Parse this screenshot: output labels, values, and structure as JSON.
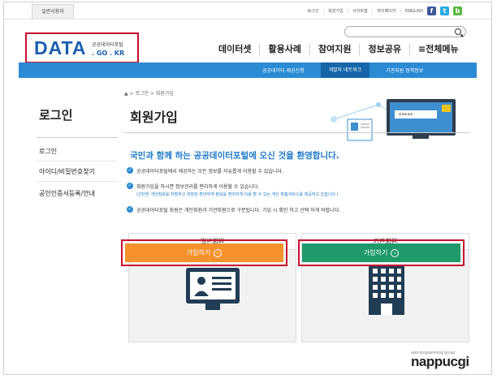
{
  "colors": {
    "brand_blue": "#1b5fae",
    "nav_bar": "#2a8bd4",
    "highlight_red": "#c8102e",
    "orange_button": "#f5922b",
    "green_button": "#1f9a6a"
  },
  "topbar": {
    "user_tab": "일반사용자",
    "links": [
      "로그인",
      "회원가입",
      "사이트맵",
      "마이페이지",
      "ENGLISH"
    ],
    "social_icons": [
      "facebook-icon",
      "twitter-icon",
      "blog-icon"
    ]
  },
  "logo": {
    "main": "DATA",
    "sub": "공공데이터포털",
    "domain": ". GO . KR"
  },
  "main_nav": [
    "데이터셋",
    "활용사례",
    "참여지원",
    "정보공유",
    "≡전체메뉴"
  ],
  "sub_nav": [
    "공공데이터 제공신청",
    "개발자 네트워크",
    "기관지원 정책정보"
  ],
  "sidebar": {
    "title": "로그인",
    "items": [
      "로그인",
      "아이디/비밀번호찾기",
      "공인인증서등록/안내"
    ]
  },
  "breadcrumb": "▲ > 로그인 > 회원가입",
  "page_title": "회원가입",
  "welcome": "국민과 함께 하는 공공데이터포털에 오신 것을 환영합니다.",
  "bullets": [
    {
      "text": "공공데이터포털에서 제공하는 모든 정보를 자유롭게 이용할 수 있습니다.",
      "note": ""
    },
    {
      "text": "회원가입을 하시면 정보관리를 편리하게 이용할 수 있습니다.",
      "note": "(간단한 개인정보를 저장하고 저장된 편리하게 정보를 편리하게 이용 할 수 있는 개인 맞춤서비스를 제공하고 있습니다.)"
    },
    {
      "text": "공공데이터포털 회원은 개인회원과 기관회원으로 구분됩니다. 가입 시 확인 하고 선택 하게 바랍니다.",
      "note": ""
    }
  ],
  "cards": [
    {
      "label": "일반회원",
      "button": "가입하기",
      "icon": "id-card-icon"
    },
    {
      "label": "기관회원",
      "button": "가입하기",
      "icon": "building-icon"
    }
  ],
  "watermark": {
    "small": "web programming group",
    "big": "nappucgi"
  }
}
